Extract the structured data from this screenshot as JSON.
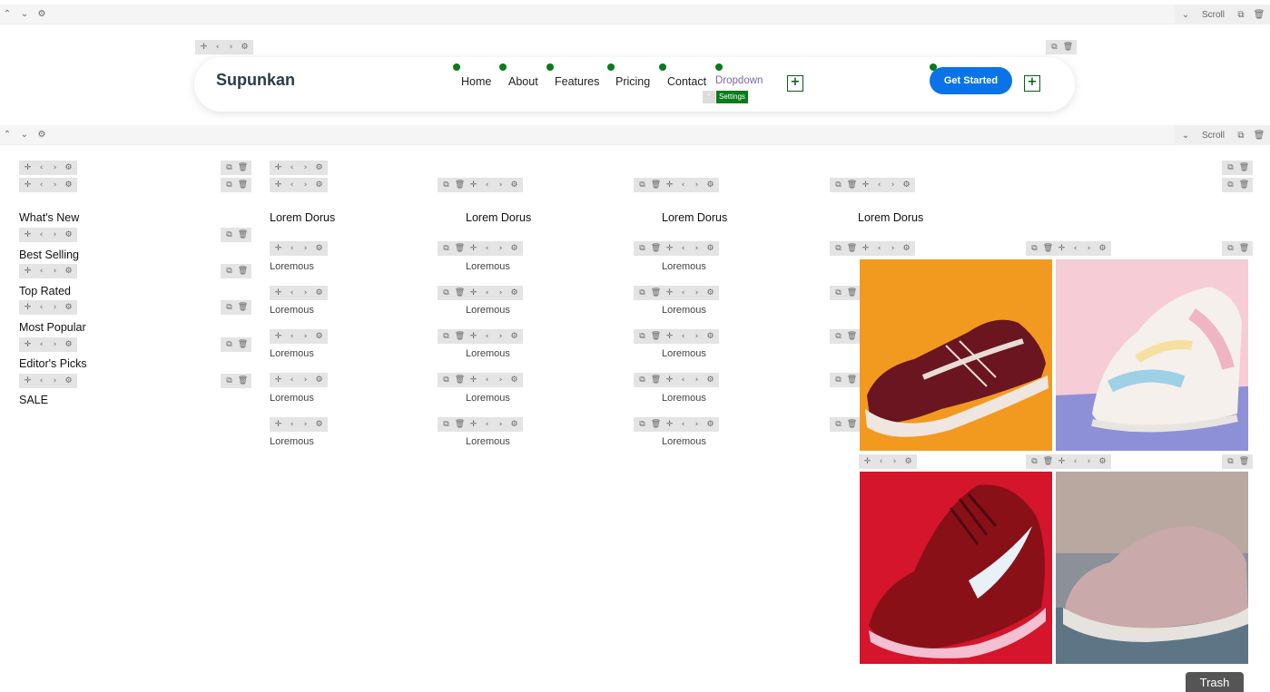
{
  "header": {
    "brand": "Supunkan",
    "nav_items": [
      "Home",
      "About",
      "Features",
      "Pricing",
      "Contact"
    ],
    "dropdown_label": "Dropdown",
    "settings_label": "Settings",
    "cta_label": "Get Started"
  },
  "toolbar": {
    "scroll_label": "Scroll"
  },
  "mega_menu": {
    "sidebar": [
      "What's New",
      "Best Selling",
      "Top Rated",
      "Most Popular",
      "Editor's Picks",
      "SALE"
    ],
    "columns": [
      {
        "heading": "Lorem Dorus",
        "items": [
          "Loremous",
          "Loremous",
          "Loremous",
          "Loremous",
          "Loremous"
        ]
      },
      {
        "heading": "Lorem Dorus",
        "items": [
          "Loremous",
          "Loremous",
          "Loremous",
          "Loremous",
          "Loremous"
        ]
      },
      {
        "heading": "Lorem Dorus",
        "items": [
          "Loremous",
          "Loremous",
          "Loremous",
          "Loremous",
          "Loremous"
        ]
      },
      {
        "heading": "Lorem Dorus"
      }
    ],
    "images": [
      "dark-red-skate-shoe",
      "pastel-sneaker",
      "red-nike-running-shoe",
      "pink-sneaker"
    ]
  },
  "footer": {
    "trash_label": "Trash"
  },
  "colors": {
    "accent": "#0b73e8",
    "indicator": "#0a7a1a",
    "dropdown_text": "#7a6aa8"
  }
}
